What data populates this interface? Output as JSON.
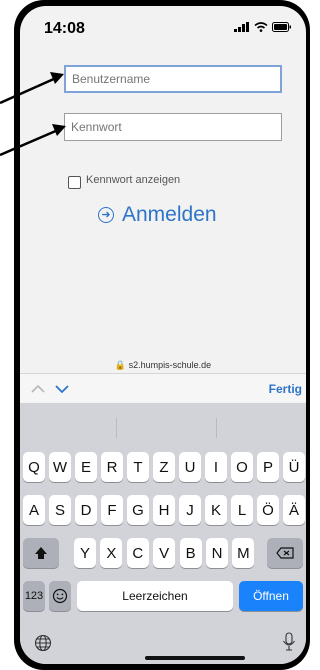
{
  "status_bar": {
    "time": "14:08"
  },
  "form": {
    "username_placeholder": "Benutzername",
    "password_placeholder": "Kennwort",
    "show_password_label": "Kennwort anzeigen",
    "login_label": "Anmelden"
  },
  "browser": {
    "url": "s2.humpis-schule.de"
  },
  "accessory_bar": {
    "done_label": "Fertig"
  },
  "keyboard": {
    "row1": [
      "Q",
      "W",
      "E",
      "R",
      "T",
      "Z",
      "U",
      "I",
      "O",
      "P",
      "Ü"
    ],
    "row2": [
      "A",
      "S",
      "D",
      "F",
      "G",
      "H",
      "J",
      "K",
      "L",
      "Ö",
      "Ä"
    ],
    "row3": [
      "Y",
      "X",
      "C",
      "V",
      "B",
      "N",
      "M"
    ],
    "numbers_label": "123",
    "space_label": "Leerzeichen",
    "return_label": "Öffnen"
  },
  "colors": {
    "accent": "#2e74c9",
    "keyboard_bg": "#d1d3d9",
    "return_key": "#1a82fb"
  }
}
